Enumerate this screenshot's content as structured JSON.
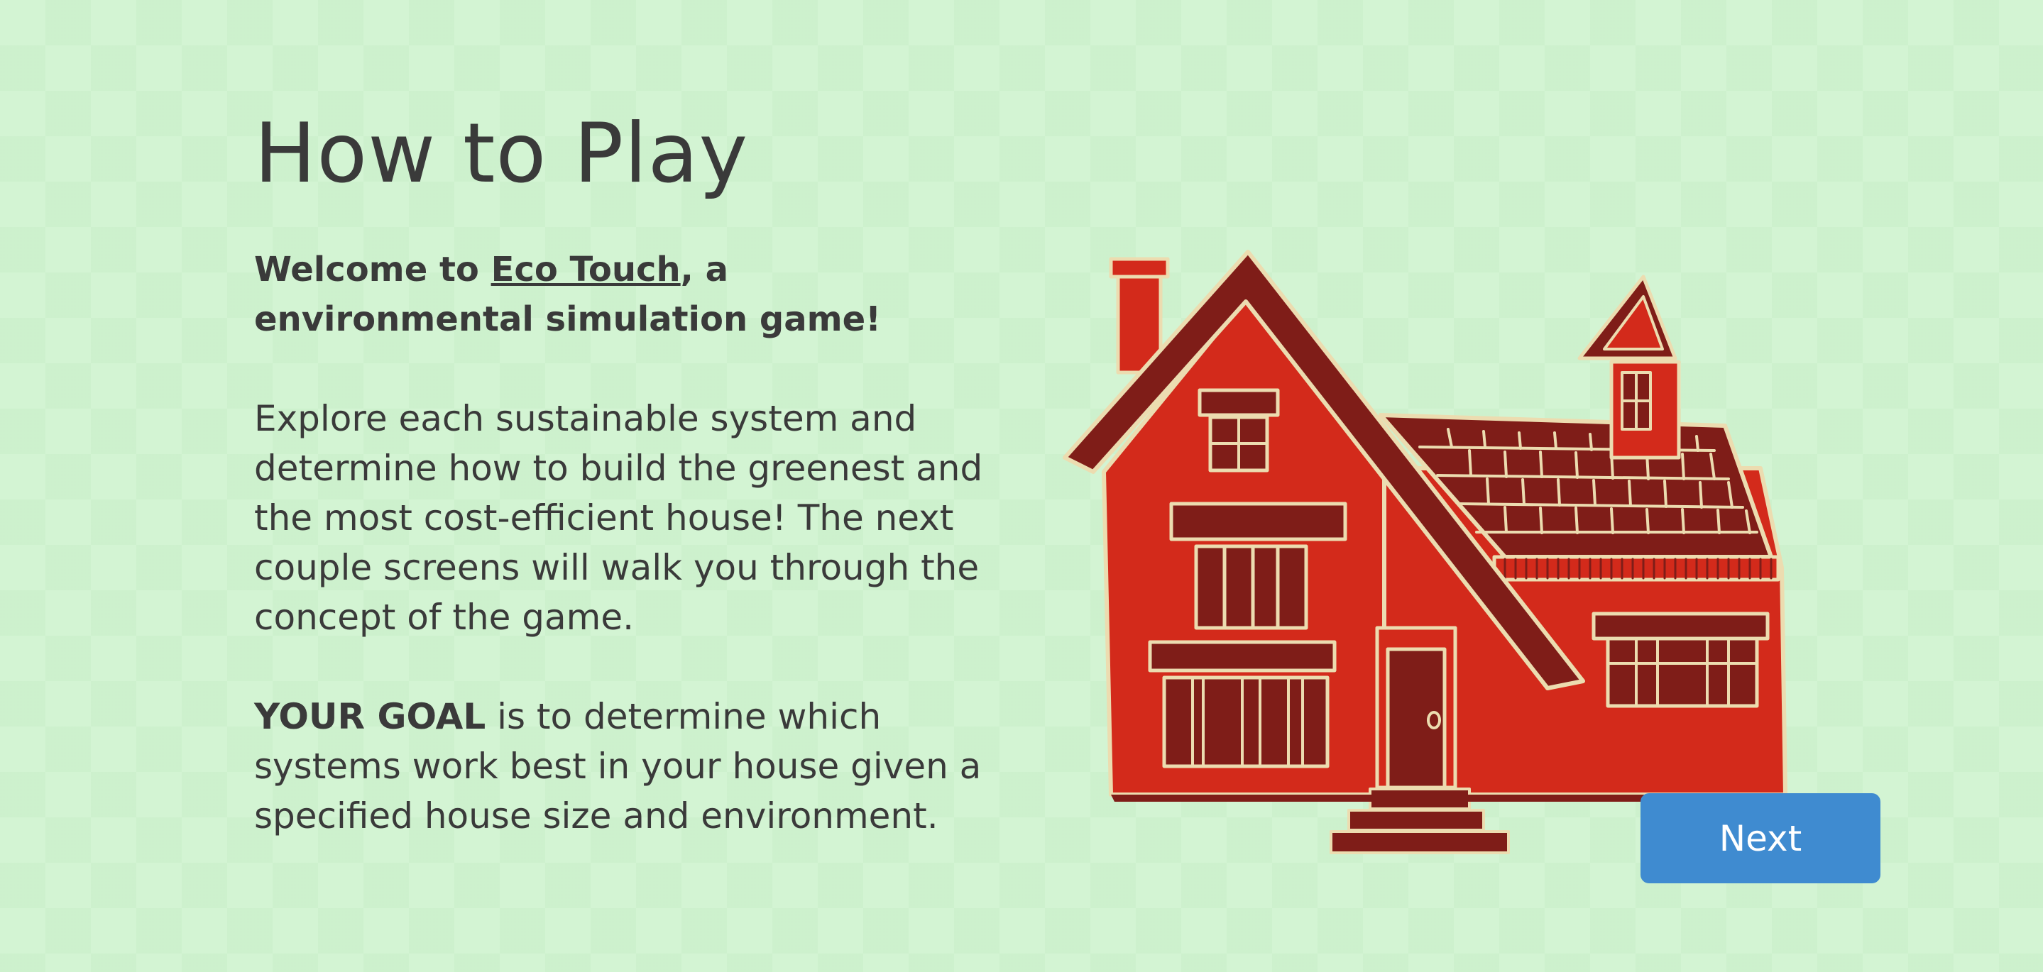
{
  "page": {
    "title": "How to Play"
  },
  "welcome": {
    "prefix": "Welcome to ",
    "game_name": "Eco Touch",
    "suffix": ", a environmental simulation game!"
  },
  "intro": {
    "text": "Explore each sustainable system and determine how to build the greenest and the most cost-efficient house! The next couple screens will walk you through the concept of the game."
  },
  "goal": {
    "label": "YOUR GOAL",
    "text": " is to determine which systems work best in your house given a specified house size and environment."
  },
  "actions": {
    "next_label": "Next"
  },
  "illustration": {
    "icon": "red-house-illustration",
    "colors": {
      "wall": "#d32a1b",
      "dark": "#7f1d18",
      "trim": "#ecdcb0",
      "background": "#d3f4d3",
      "button": "#3f8bd0"
    }
  }
}
